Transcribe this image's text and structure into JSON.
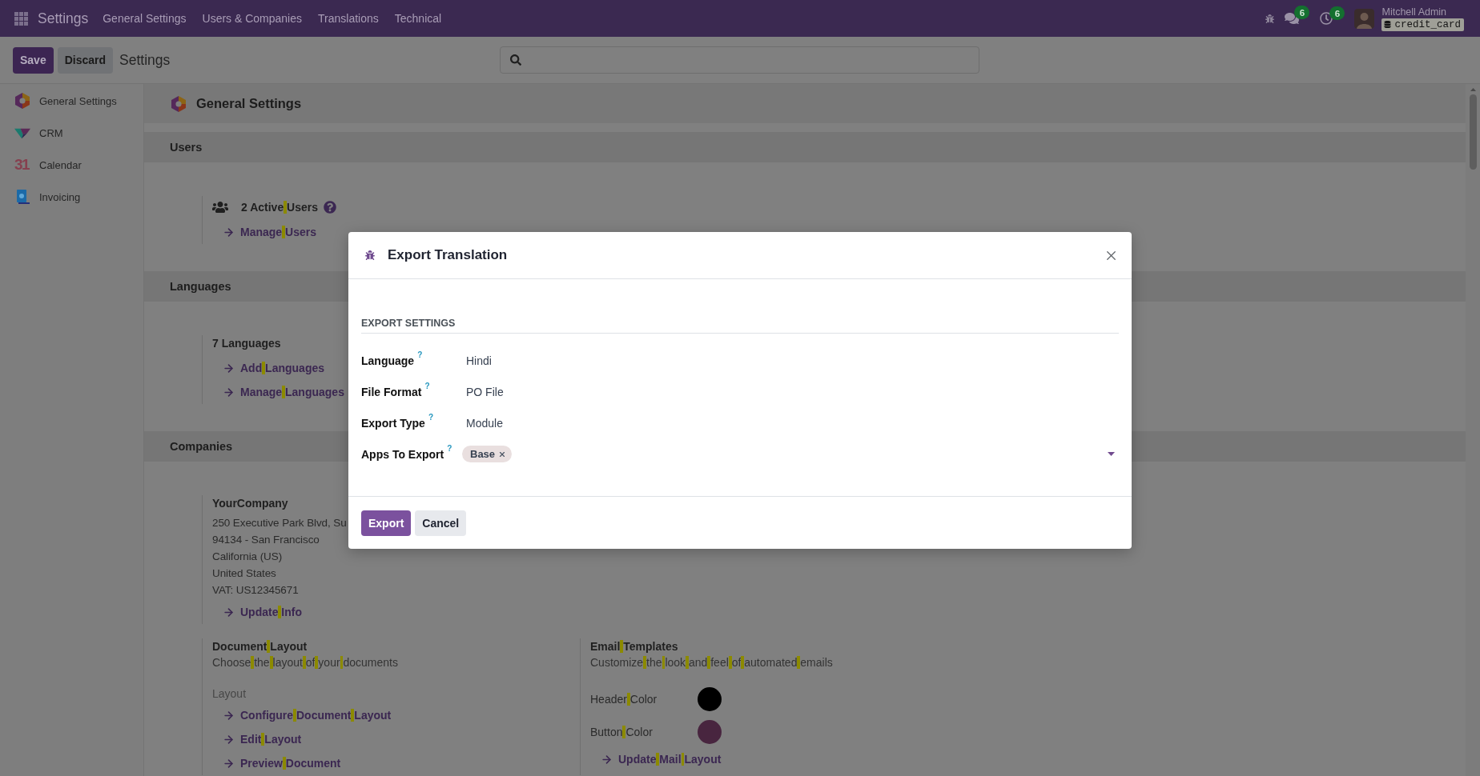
{
  "navbar": {
    "app_name": "Settings",
    "menu": [
      {
        "label": "General Settings"
      },
      {
        "label": "Users & Companies"
      },
      {
        "label": "Translations"
      },
      {
        "label": "Technical"
      }
    ],
    "systray": [
      {
        "kind": "debug"
      },
      {
        "kind": "messages",
        "badge": "6"
      },
      {
        "kind": "activities",
        "badge": "6"
      }
    ],
    "user": {
      "name": "Mitchell Admin",
      "database": "credit_card"
    }
  },
  "control_panel": {
    "buttons": [
      {
        "label": "Save",
        "kind": "primary"
      },
      {
        "label": "Discard",
        "kind": "secondary"
      }
    ],
    "breadcrumb": "Settings"
  },
  "sidebar": {
    "items": [
      {
        "label": "General Settings",
        "kind": "settings"
      },
      {
        "label": "CRM",
        "kind": "crm"
      },
      {
        "label": "Calendar",
        "kind": "calendar",
        "icon_text": "31"
      },
      {
        "label": "Invoicing",
        "kind": "invoicing"
      }
    ]
  },
  "page": {
    "title": "General Settings",
    "search_highlight": true,
    "sections": [
      {
        "title": "Users",
        "rows": [
          {
            "blocks": [
              {
                "lines": [
                  {
                    "kind": "stat",
                    "count": "2",
                    "label": "Active Users",
                    "help": true
                  },
                  {
                    "kind": "link",
                    "label": "Manage Users"
                  }
                ]
              }
            ]
          }
        ]
      },
      {
        "title": "Languages",
        "rows": [
          {
            "blocks": [
              {
                "lines": [
                  {
                    "kind": "record_title",
                    "text": "7 Languages"
                  },
                  {
                    "kind": "link",
                    "label": "Add Languages"
                  },
                  {
                    "kind": "link",
                    "label": "Manage Languages"
                  }
                ]
              }
            ]
          }
        ]
      },
      {
        "title": "Companies",
        "rows": [
          {
            "blocks": [
              {
                "lines": [
                  {
                    "kind": "record_title",
                    "text": "YourCompany"
                  },
                  {
                    "kind": "address",
                    "text": "250 Executive Park Blvd, Su"
                  },
                  {
                    "kind": "address",
                    "text": "94134 - San Francisco"
                  },
                  {
                    "kind": "address",
                    "text": "California (US)"
                  },
                  {
                    "kind": "address",
                    "text": "United States"
                  },
                  {
                    "kind": "address",
                    "text": "VAT: US12345671"
                  },
                  {
                    "kind": "link",
                    "label": "Update Info"
                  }
                ]
              }
            ]
          },
          {
            "blocks": [
              {
                "lines": [
                  {
                    "kind": "title",
                    "text": "Document Layout"
                  },
                  {
                    "kind": "description",
                    "text": "Choose the layout of your documents"
                  },
                  {
                    "kind": "caption",
                    "text": "Layout"
                  },
                  {
                    "kind": "link",
                    "label": "Configure Document Layout"
                  },
                  {
                    "kind": "link",
                    "label": "Edit Layout"
                  },
                  {
                    "kind": "link",
                    "label": "Preview Document"
                  }
                ]
              },
              {
                "lines": [
                  {
                    "kind": "title",
                    "text": "Email Templates"
                  },
                  {
                    "kind": "description",
                    "text": "Customize the look and feel of automated emails"
                  },
                  {
                    "kind": "color",
                    "label": "Header Color",
                    "color": "#000000"
                  },
                  {
                    "kind": "color",
                    "label": "Button Color",
                    "color": "#48253f"
                  },
                  {
                    "kind": "link",
                    "label": "Update Mail Layout"
                  }
                ]
              }
            ]
          }
        ]
      }
    ]
  },
  "dialog": {
    "title": "Export Translation",
    "section": "EXPORT SETTINGS",
    "fields": [
      {
        "label": "Language",
        "help": "?",
        "kind": "select",
        "value": "Hindi"
      },
      {
        "label": "File Format",
        "help": "?",
        "kind": "select",
        "value": "PO File"
      },
      {
        "label": "Export Type",
        "help": "?",
        "kind": "select",
        "value": "Module"
      },
      {
        "label": "Apps To Export",
        "help": "?",
        "kind": "tags",
        "tags": [
          {
            "label": "Base"
          }
        ]
      }
    ],
    "buttons": [
      {
        "label": "Export",
        "kind": "primary"
      },
      {
        "label": "Cancel",
        "kind": "secondary"
      }
    ]
  }
}
